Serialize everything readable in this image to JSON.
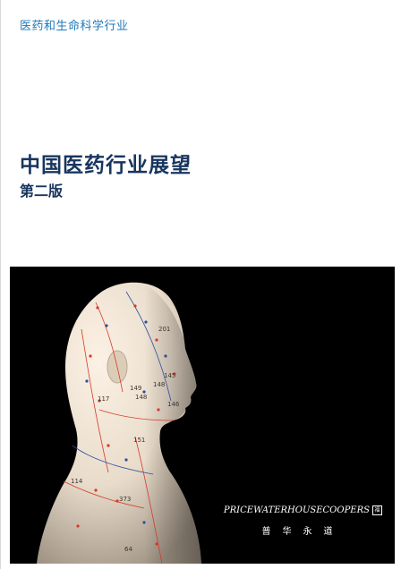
{
  "sector_label": "医药和生命科学行业",
  "title": "中国医药行业展望",
  "edition": "第二版",
  "cover_photo": {
    "acupoint_numbers": [
      "201",
      "149",
      "145",
      "117",
      "148",
      "148",
      "146",
      "151",
      "114",
      "373",
      "64"
    ]
  },
  "brand": {
    "name": "PRICEWATERHOUSECOOPERS",
    "seal": "福",
    "name_cn": "普华永道"
  },
  "colors": {
    "sector_blue": "#1f78b9",
    "title_navy": "#17355e",
    "photo_bg": "#000000",
    "acupoint_red": "#d43a2a",
    "acupoint_blue": "#2b4f9e"
  }
}
